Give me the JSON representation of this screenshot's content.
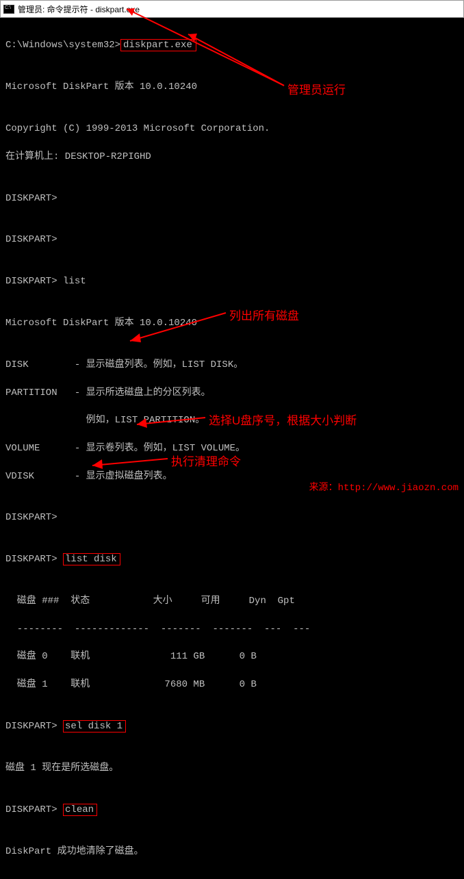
{
  "window": {
    "title": "管理员: 命令提示符 - diskpart.exe"
  },
  "terminal": {
    "prompt_path": "C:\\Windows\\system32>",
    "cmd_diskpart": "diskpart.exe",
    "blank": "",
    "ver1": "Microsoft DiskPart 版本 10.0.10240",
    "copyright": "Copyright (C) 1999-2013 Microsoft Corporation.",
    "on_computer": "在计算机上: DESKTOP-R2PIGHD",
    "dp_prompt": "DISKPART>",
    "cmd_list": "list",
    "ver2": "Microsoft DiskPart 版本 10.0.10240",
    "help_disk": "DISK        - 显示磁盘列表。例如，LIST DISK。",
    "help_partition": "PARTITION   - 显示所选磁盘上的分区列表。",
    "help_partition2": "              例如，LIST PARTITION。",
    "help_volume": "VOLUME      - 显示卷列表。例如，LIST VOLUME。",
    "help_vdisk": "VDISK       - 显示虚拟磁盘列表。",
    "cmd_listdisk": "list disk",
    "tbl_head": "  磁盘 ###  状态           大小     可用     Dyn  Gpt",
    "tbl_sep": "  --------  -------------  -------  -------  ---  ---",
    "tbl_row0": "  磁盘 0    联机              111 GB      0 B",
    "tbl_row1": "  磁盘 1    联机             7680 MB      0 B",
    "cmd_seldisk": "sel disk 1",
    "sel_msg": "磁盘 1 现在是所选磁盘。",
    "cmd_clean": "clean",
    "clean_msg": "DiskPart 成功地清除了磁盘。"
  },
  "annotations": {
    "admin_run": "管理员运行",
    "list_all": "列出所有磁盘",
    "select_u": "选择U盘序号，根据大小判断",
    "do_clean": "执行清理命令"
  },
  "watermark": {
    "prefix": "来源：",
    "url": "http://www.jiaozn.com"
  }
}
